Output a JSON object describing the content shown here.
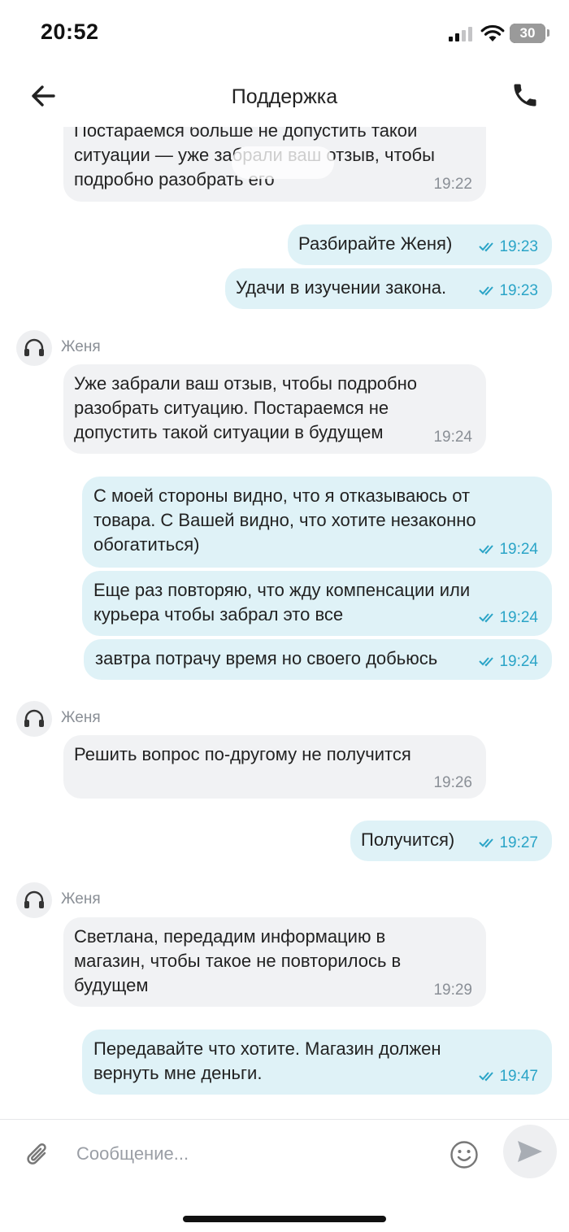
{
  "status_bar": {
    "time": "20:52",
    "battery": "30"
  },
  "header": {
    "title": "Поддержка"
  },
  "chat": {
    "top_partial_message": {
      "text": "Постараемся больше не допустить такой\nситуации — уже забрали ваш отзыв, чтобы\nподробно разобрать его",
      "time": "19:22"
    },
    "out_1": {
      "text": "Разбирайте Женя)",
      "time": "19:23"
    },
    "out_2": {
      "text": "Удачи в изучении закона.",
      "time": "19:23"
    },
    "sender_1": {
      "name": "Женя"
    },
    "in_1": {
      "text": "Уже забрали ваш отзыв, чтобы подробно\nразобрать ситуацию. Постараемся не\nдопустить такой ситуации в будущем",
      "time": "19:24"
    },
    "out_3": {
      "text": "С моей стороны видно, что я отказываюсь от\nтовара. С Вашей видно, что хотите незаконно\nобогатиться)",
      "time": "19:24"
    },
    "out_4": {
      "text": "Еще раз повторяю, что жду компенсации или\nкурьера чтобы забрал это все",
      "time": "19:24"
    },
    "out_5": {
      "text": "завтра потрачу время но своего добьюсь",
      "time": "19:24"
    },
    "sender_2": {
      "name": "Женя"
    },
    "in_2": {
      "text": "Решить вопрос по-другому не получится",
      "time": "19:26"
    },
    "out_6": {
      "text": "Получится)",
      "time": "19:27"
    },
    "sender_3": {
      "name": "Женя"
    },
    "in_3": {
      "text": "Светлана, передадим информацию в\nмагазин, чтобы такое не повторилось в\nбудущем",
      "time": "19:29"
    },
    "out_7": {
      "text": "Передавайте что хотите. Магазин должен\nвернуть мне деньги.",
      "time": "19:47"
    }
  },
  "composer": {
    "placeholder": "Сообщение..."
  },
  "icons": {
    "back": "arrow-left-icon",
    "call": "phone-icon",
    "avatar": "headset-icon",
    "read_status": "double-check-icon",
    "attach": "paperclip-icon",
    "emoji": "smiley-icon",
    "send": "send-icon"
  },
  "colors": {
    "incoming_bubble": "#f1f2f4",
    "outgoing_bubble": "#dff2f7",
    "read_accent": "#2aa4c7"
  }
}
